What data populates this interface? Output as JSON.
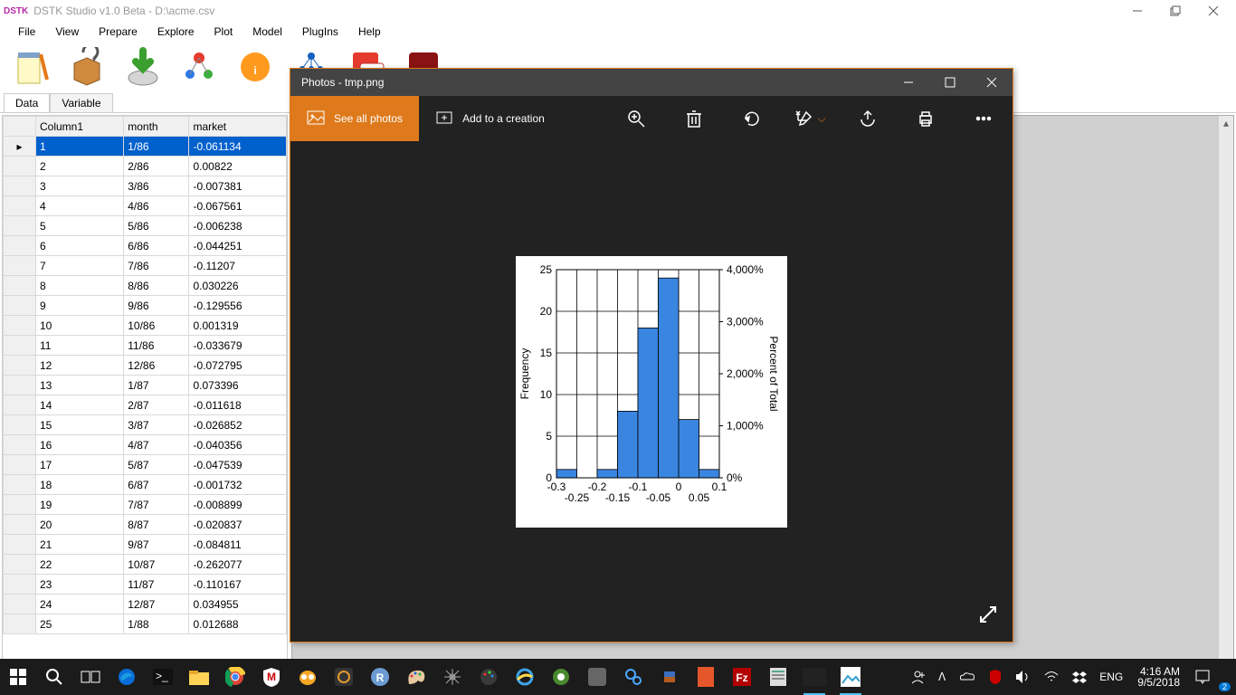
{
  "main": {
    "logo": "DSTK",
    "title": "DSTK Studio v1.0 Beta - D:\\acme.csv",
    "menus": [
      "File",
      "View",
      "Prepare",
      "Explore",
      "Plot",
      "Model",
      "PlugIns",
      "Help"
    ],
    "tabs": [
      "Data",
      "Variable"
    ],
    "active_tab": 0,
    "columns": [
      "Column1",
      "month",
      "market"
    ],
    "rows": [
      {
        "c1": "1",
        "month": "1/86",
        "market": "-0.061134",
        "sel": true
      },
      {
        "c1": "2",
        "month": "2/86",
        "market": "0.00822"
      },
      {
        "c1": "3",
        "month": "3/86",
        "market": "-0.007381"
      },
      {
        "c1": "4",
        "month": "4/86",
        "market": "-0.067561"
      },
      {
        "c1": "5",
        "month": "5/86",
        "market": "-0.006238"
      },
      {
        "c1": "6",
        "month": "6/86",
        "market": "-0.044251"
      },
      {
        "c1": "7",
        "month": "7/86",
        "market": "-0.11207"
      },
      {
        "c1": "8",
        "month": "8/86",
        "market": "0.030226"
      },
      {
        "c1": "9",
        "month": "9/86",
        "market": "-0.129556"
      },
      {
        "c1": "10",
        "month": "10/86",
        "market": "0.001319"
      },
      {
        "c1": "11",
        "month": "11/86",
        "market": "-0.033679"
      },
      {
        "c1": "12",
        "month": "12/86",
        "market": "-0.072795"
      },
      {
        "c1": "13",
        "month": "1/87",
        "market": "0.073396"
      },
      {
        "c1": "14",
        "month": "2/87",
        "market": "-0.011618"
      },
      {
        "c1": "15",
        "month": "3/87",
        "market": "-0.026852"
      },
      {
        "c1": "16",
        "month": "4/87",
        "market": "-0.040356"
      },
      {
        "c1": "17",
        "month": "5/87",
        "market": "-0.047539"
      },
      {
        "c1": "18",
        "month": "6/87",
        "market": "-0.001732"
      },
      {
        "c1": "19",
        "month": "7/87",
        "market": "-0.008899"
      },
      {
        "c1": "20",
        "month": "8/87",
        "market": "-0.020837"
      },
      {
        "c1": "21",
        "month": "9/87",
        "market": "-0.084811"
      },
      {
        "c1": "22",
        "month": "10/87",
        "market": "-0.262077"
      },
      {
        "c1": "23",
        "month": "11/87",
        "market": "-0.110167"
      },
      {
        "c1": "24",
        "month": "12/87",
        "market": "0.034955"
      },
      {
        "c1": "25",
        "month": "1/88",
        "market": "0.012688"
      }
    ]
  },
  "photos": {
    "title": "Photos - tmp.png",
    "see_all": "See all photos",
    "add_to": "Add to a creation"
  },
  "chart_data": {
    "type": "bar",
    "ylabel": "Frequency",
    "ylabel2": "Percent of Total",
    "x_ticks_major": [
      "-0.3",
      "-0.2",
      "-0.1",
      "0",
      "0.1"
    ],
    "x_ticks_minor": [
      "-0.25",
      "-0.15",
      "-0.05",
      "0.05"
    ],
    "y_ticks": [
      0,
      5,
      10,
      15,
      20,
      25
    ],
    "y2_ticks": [
      "0%",
      "1,000%",
      "2,000%",
      "3,000%",
      "4,000%"
    ],
    "bin_edges": [
      -0.3,
      -0.25,
      -0.2,
      -0.15,
      -0.1,
      -0.05,
      0.0,
      0.05,
      0.1
    ],
    "values": [
      1,
      0,
      1,
      8,
      18,
      24,
      7,
      1
    ]
  },
  "taskbar": {
    "lang": "ENG",
    "time": "4:16 AM",
    "date": "9/5/2018",
    "notif": "2"
  }
}
